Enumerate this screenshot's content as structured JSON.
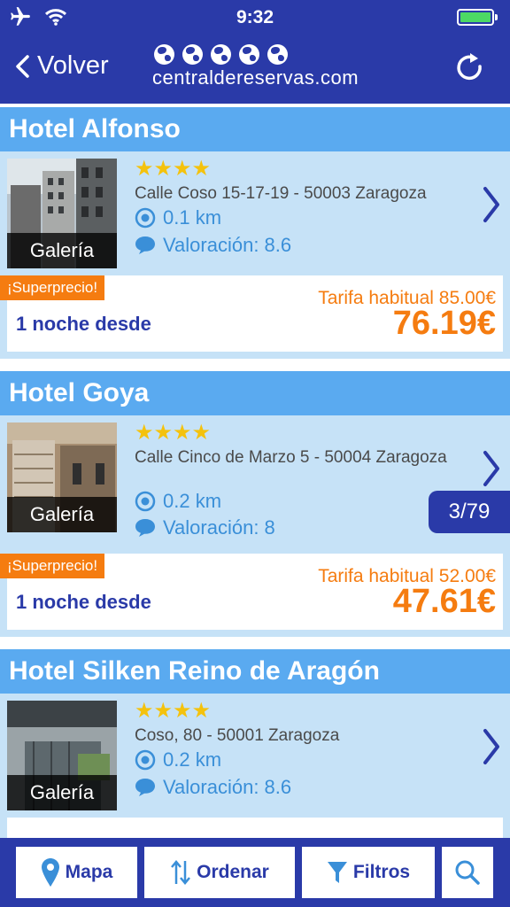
{
  "status_bar": {
    "time": "9:32",
    "airplane_icon": "airplane-icon",
    "wifi_icon": "wifi-icon",
    "battery_icon": "battery-icon",
    "battery_color": "#4cd964"
  },
  "nav": {
    "back_label": "Volver",
    "logo_text": "centraldereservas.com",
    "refresh_icon": "refresh-icon"
  },
  "colors": {
    "brand_blue": "#2a3aa8",
    "header_blue": "#5aaaf0",
    "card_bg": "#c6e2f7",
    "accent_orange": "#f57c10",
    "link_blue": "#3a8fd8",
    "star_yellow": "#f4c20d"
  },
  "hotels": [
    {
      "name": "Hotel Alfonso",
      "stars": "★★★★",
      "address": "Calle Coso 15-17-19 - 50003 Zaragoza",
      "distance": "0.1 km",
      "rating": "Valoración: 8.6",
      "gallery_label": "Galería",
      "promo": "¡Superprecio!",
      "regular_price": "Tarifa habitual 85.00€",
      "night_label": "1 noche desde",
      "price": "76.19€"
    },
    {
      "name": "Hotel Goya",
      "stars": "★★★★",
      "address": "Calle Cinco de Marzo 5 - 50004 Zaragoza",
      "distance": "0.2 km",
      "rating": "Valoración: 8",
      "gallery_label": "Galería",
      "promo": "¡Superprecio!",
      "regular_price": "Tarifa habitual 52.00€",
      "night_label": "1 noche desde",
      "price": "47.61€"
    },
    {
      "name": "Hotel Silken Reino de Aragón",
      "stars": "★★★★",
      "address": "Coso, 80 - 50001 Zaragoza",
      "distance": "0.2 km",
      "rating": "Valoración: 8.6",
      "gallery_label": "Galería"
    }
  ],
  "pager": {
    "counter": "3/79"
  },
  "toolbar": {
    "map_label": "Mapa",
    "sort_label": "Ordenar",
    "filter_label": "Filtros",
    "search_icon": "search-icon"
  }
}
